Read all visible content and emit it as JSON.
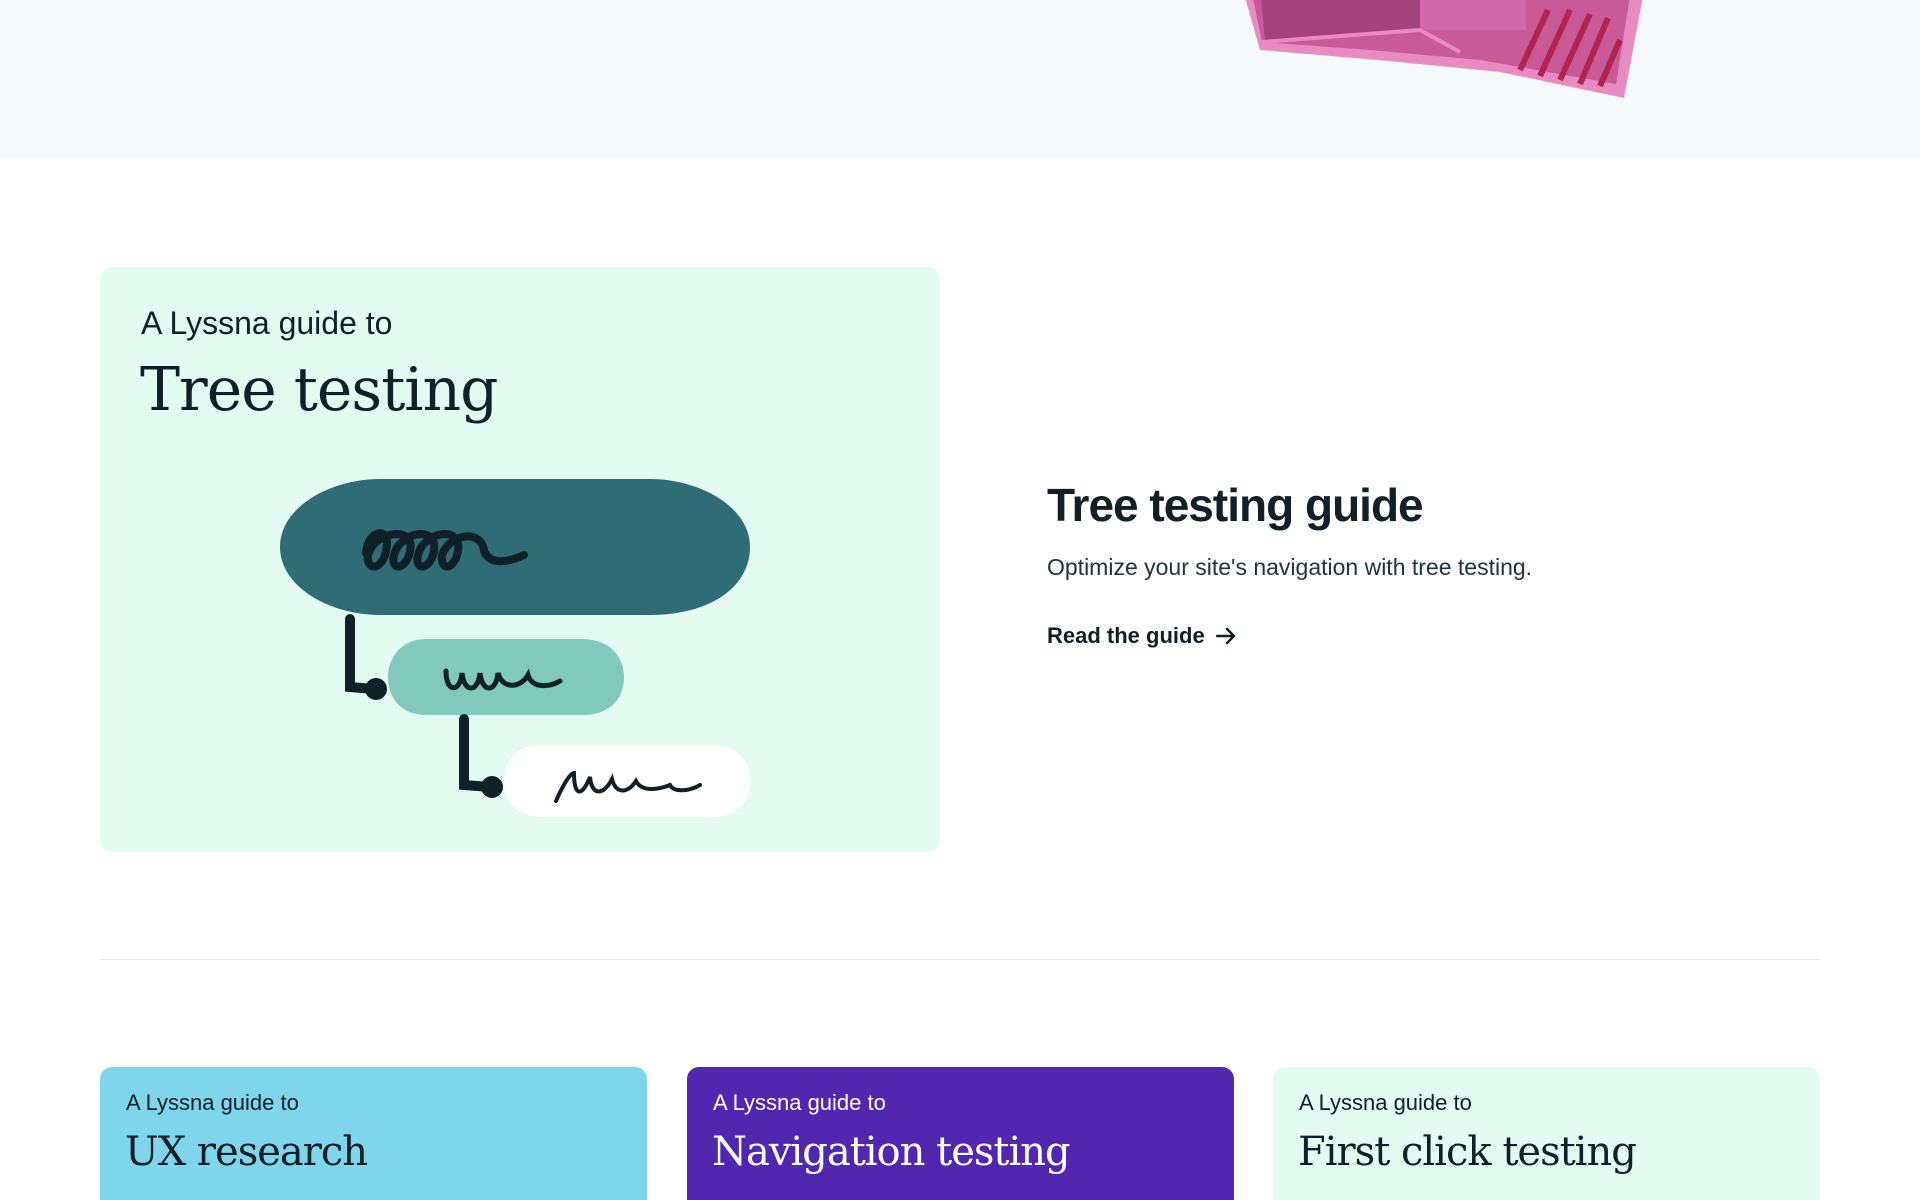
{
  "featured": {
    "kicker": "A Lyssna guide to",
    "title": "Tree testing",
    "guide_title": "Tree testing guide",
    "guide_description": "Optimize your site's navigation with tree testing.",
    "link_label": "Read the guide",
    "link_icon": "arrow-right-icon",
    "card_color": "#e4fbf1"
  },
  "guides": [
    {
      "kicker": "A Lyssna guide to",
      "title": "UX research",
      "bg": "#7fd5ec",
      "fg": "#0f2027"
    },
    {
      "kicker": "A Lyssna guide to",
      "title": "Navigation testing",
      "bg": "#5227b0",
      "fg": "#ffffff"
    },
    {
      "kicker": "A Lyssna guide to",
      "title": "First click testing",
      "bg": "#e4fbf1",
      "fg": "#0f2027"
    }
  ],
  "colors": {
    "hero_bg": "#f6f9fb",
    "tree_dark": "#2f6d76",
    "tree_mid": "#80c9bb",
    "ink": "#0f2027",
    "pink": "#c95a98",
    "magenta": "#a3437d"
  }
}
